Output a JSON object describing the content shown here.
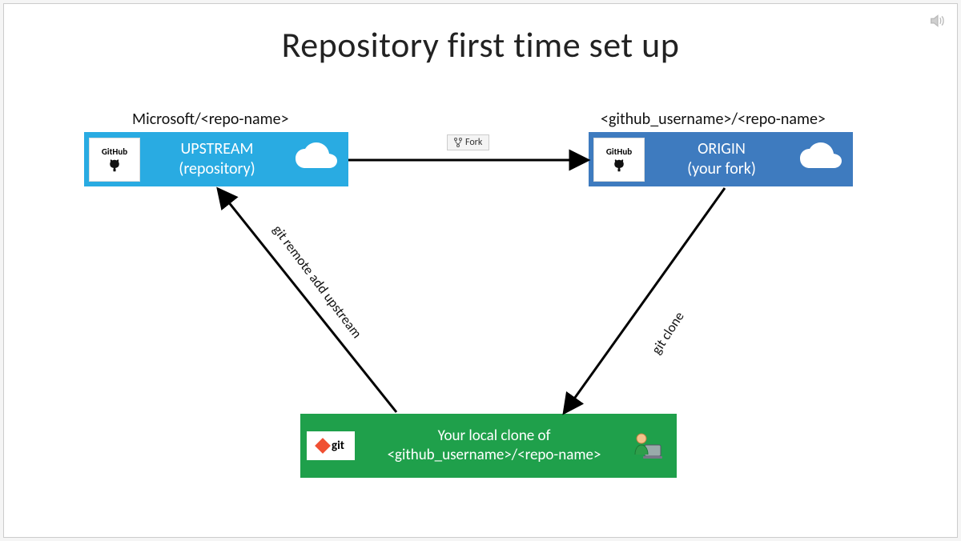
{
  "title": "Repository first time set up",
  "upstream_caption": "Microsoft/<repo-name>",
  "origin_caption": "<github_username>/<repo-name>",
  "upstream_label_line1": "UPSTREAM",
  "upstream_label_line2": "(repository)",
  "origin_label_line1": "ORIGIN",
  "origin_label_line2": "(your fork)",
  "local_label_line1": "Your local clone of",
  "local_label_line2": "<github_username>/<repo-name>",
  "github_badge": "GitHub",
  "git_badge": "git",
  "fork_label": "Fork",
  "arrow_remote": "git remote add upstream",
  "arrow_clone": "git clone",
  "colors": {
    "upstream": "#29ABE2",
    "origin": "#3E7BBF",
    "local": "#1FA04B"
  }
}
